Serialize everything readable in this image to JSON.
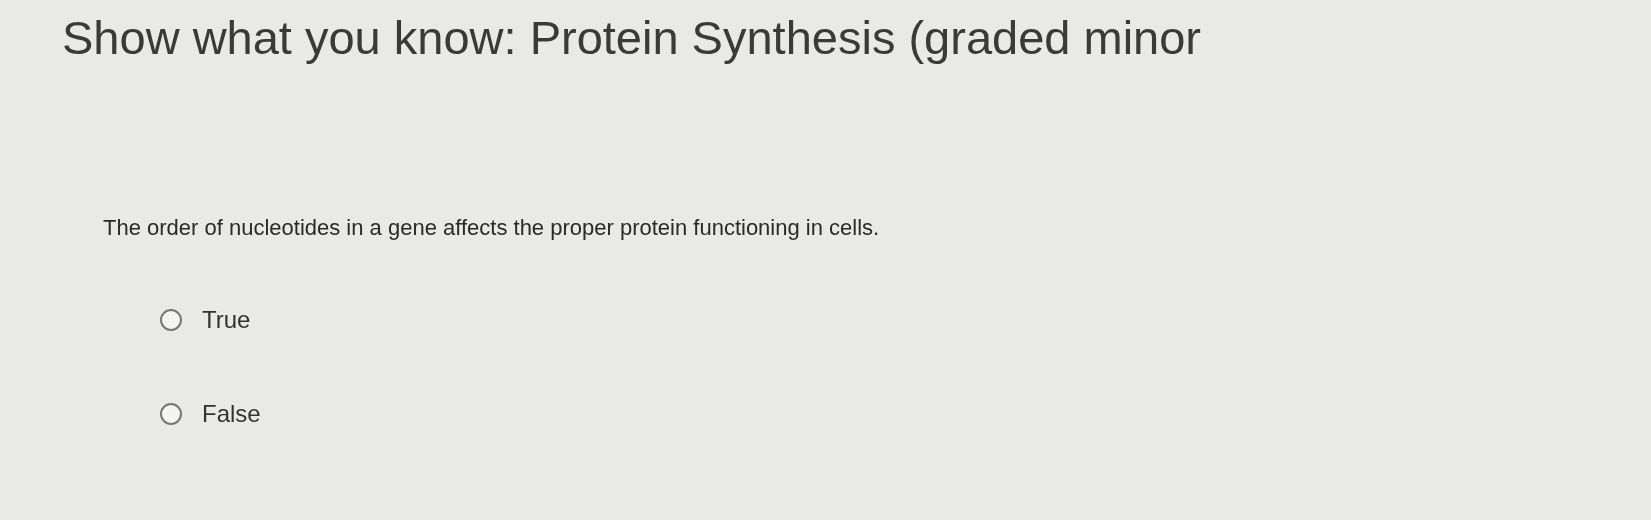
{
  "title": "Show what you know: Protein Synthesis (graded minor",
  "question": "The order of nucleotides in a gene affects the proper protein functioning in cells.",
  "options": [
    {
      "label": "True",
      "selected": false
    },
    {
      "label": "False",
      "selected": false
    }
  ]
}
